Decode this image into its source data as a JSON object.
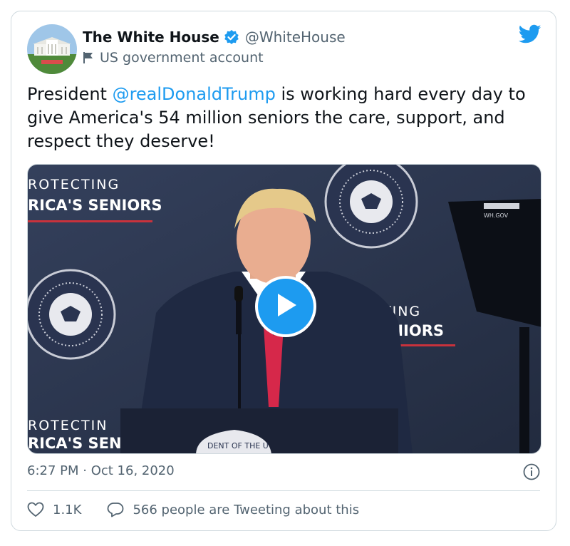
{
  "account": {
    "name": "The White House",
    "handle": "@WhiteHouse",
    "label": "US government account"
  },
  "tweet": {
    "text_before": "President ",
    "mention": "@realDonaldTrump",
    "text_after": " is working hard every day to give America's 54 million seniors the care, support, and respect they deserve!",
    "timestamp": "6:27 PM · Oct 16, 2020"
  },
  "media": {
    "banner_top_line1": "ROTECTING",
    "banner_top_line2": "RICA'S SENIORS",
    "banner_mid_line1": "TING",
    "banner_mid_line2": "SENIORS",
    "banner_bottom_line1": "ROTECTIN",
    "banner_bottom_line2": "RICA'S SEN",
    "teleprompter_text": "WH.GOV",
    "seal_text": "DENT OF THE U"
  },
  "engagement": {
    "likes": "1.1K",
    "tweeting": "566 people are Tweeting about this"
  },
  "colors": {
    "accent": "#1d9bf0",
    "backdrop": "#2b3650",
    "tie": "#d6284a"
  },
  "icons": [
    "verified-badge-icon",
    "government-flag-icon",
    "twitter-bird-icon",
    "play-icon",
    "info-icon",
    "heart-icon",
    "reply-bubble-icon"
  ]
}
